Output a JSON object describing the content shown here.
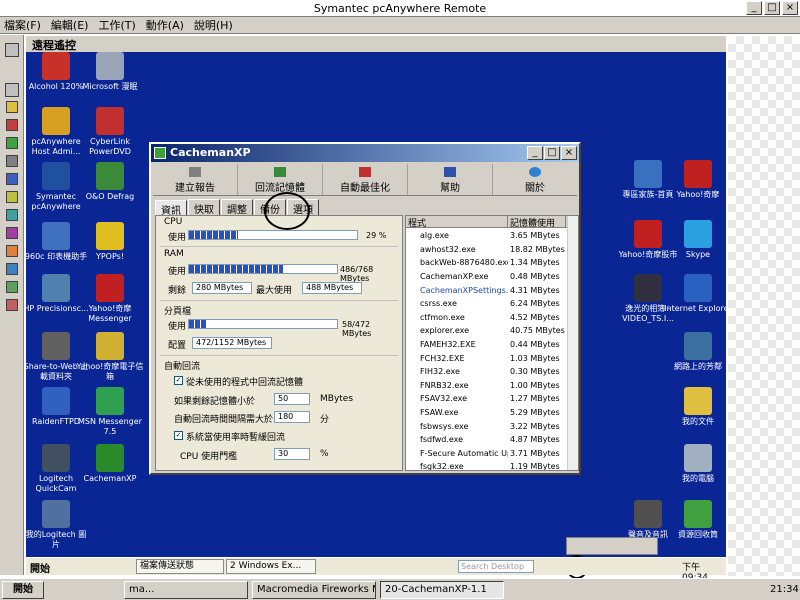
{
  "outer": {
    "title": "Symantec pcAnywhere Remote",
    "menu": [
      "檔案(F)",
      "編輯(E)",
      "工作(T)",
      "動作(A)",
      "說明(H)"
    ],
    "section_label": "遠程遙控"
  },
  "desktop": {
    "left_icons": [
      {
        "label": "Alcohol 120%",
        "color": "#c8302a"
      },
      {
        "label": "Microsoft 漫眠",
        "color": "#9aa4b8"
      },
      {
        "label": "pcAnywhere Host Admi...",
        "color": "#d8a020"
      },
      {
        "label": "CyberLink PowerDVD",
        "color": "#c03030"
      },
      {
        "label": "Symantec pcAnywhere",
        "color": "#2050a0"
      },
      {
        "label": "O&O Defrag",
        "color": "#3a8a3a"
      },
      {
        "label": "960c 印表機助手",
        "color": "#4070c0"
      },
      {
        "label": "YPOPs!",
        "color": "#e0c020"
      },
      {
        "label": "HP Precisionsc...",
        "color": "#5080b0"
      },
      {
        "label": "Yahoo!奇摩 Messenger",
        "color": "#c02020"
      },
      {
        "label": "Share-to-Web 上載資料夾",
        "color": "#606060"
      },
      {
        "label": "Yahoo!奇摩電子信箱",
        "color": "#d0b030"
      },
      {
        "label": "RaidenFTPD",
        "color": "#3060c0"
      },
      {
        "label": "MSN Messenger 7.5",
        "color": "#30a050"
      },
      {
        "label": "Logitech QuickCam",
        "color": "#405060"
      },
      {
        "label": "CachemanXP",
        "color": "#2a8a2a"
      },
      {
        "label": "我的Logitech 圖片",
        "color": "#5070a0"
      }
    ],
    "right_icons": [
      {
        "label": "專區家族-首頁",
        "color": "#3a70c0"
      },
      {
        "label": "Yahoo!奇摩",
        "color": "#c02020"
      },
      {
        "label": "Yahoo!奇摩股市",
        "color": "#c02020"
      },
      {
        "label": "Skype",
        "color": "#2aa0e0"
      },
      {
        "label": "逸光的相簿 - VIDEO_TS.I...",
        "color": "#303040"
      },
      {
        "label": "Internet Explorer",
        "color": "#2a60c0"
      },
      {
        "label": "網路上的芳鄰",
        "color": "#3a70a0"
      },
      {
        "label": "我的文件",
        "color": "#e0c040"
      },
      {
        "label": "我的電腦",
        "color": "#a0b0c0"
      },
      {
        "label": "聲音及音訊",
        "color": "#505050"
      },
      {
        "label": "資源回收筒",
        "color": "#40a040"
      }
    ]
  },
  "cacheman": {
    "title": "CachemanXP",
    "toolbar": [
      "建立報告",
      "回流記憶體",
      "自動最佳化",
      "幫助",
      "關於"
    ],
    "tabs": [
      "資訊",
      "快取",
      "調整",
      "備份",
      "選項"
    ],
    "cpu": {
      "group": "CPU",
      "row_label": "使用",
      "percent": 29,
      "value_text": "29 %"
    },
    "ram": {
      "group": "RAM",
      "row_label": "使用",
      "used_fraction": 0.633,
      "value_text": "486/768 MBytes",
      "free_label": "剩餘",
      "free_value": "280 MBytes",
      "max_label": "最大使用",
      "max_value": "488 MBytes"
    },
    "pagefile": {
      "group": "分頁檔",
      "row_label": "使用",
      "used_fraction": 0.123,
      "value_text": "58/472 MBytes",
      "config_label": "配置",
      "config_value": "472/1152 MBytes"
    },
    "auto": {
      "group": "自動回流",
      "opt1": "從未使用的程式中回流記憶體",
      "opt2_label": "如果剩餘記憶體小於",
      "opt2_value": "50",
      "opt2_unit": "MBytes",
      "opt3_label": "自動回流時間間隔需大於",
      "opt3_value": "180",
      "opt3_unit": "分",
      "opt4": "系統當使用率時暫緩回流",
      "opt5_label": "CPU 使用門檻",
      "opt5_value": "30",
      "opt5_unit": "%"
    },
    "list": {
      "headers": [
        "程式",
        "記憶體使用"
      ],
      "rows": [
        [
          "alg.exe",
          "3.65 MBytes"
        ],
        [
          "awhost32.exe",
          "18.82 MBytes"
        ],
        [
          "backWeb-8876480.exe",
          "1.34 MBytes"
        ],
        [
          "CachemanXP.exe",
          "0.48 MBytes"
        ],
        [
          "CachemanXPSettings.exe",
          "4.31 MBytes"
        ],
        [
          "csrss.exe",
          "6.24 MBytes"
        ],
        [
          "ctfmon.exe",
          "4.52 MBytes"
        ],
        [
          "explorer.exe",
          "40.75 MBytes"
        ],
        [
          "FAMEH32.EXE",
          "0.44 MBytes"
        ],
        [
          "FCH32.EXE",
          "1.03 MBytes"
        ],
        [
          "FIH32.exe",
          "0.30 MBytes"
        ],
        [
          "FNRB32.exe",
          "1.00 MBytes"
        ],
        [
          "FSAV32.exe",
          "1.27 MBytes"
        ],
        [
          "FSAW.exe",
          "5.29 MBytes"
        ],
        [
          "fsbwsys.exe",
          "3.22 MBytes"
        ],
        [
          "fsdfwd.exe",
          "4.87 MBytes"
        ],
        [
          "F-Secure Automatic Updat",
          "3.71 MBytes"
        ],
        [
          "fsgk32.exe",
          "1.19 MBytes"
        ]
      ]
    }
  },
  "remote_taskbar": {
    "start": "開始",
    "items": [
      "檔案傳送狀態",
      "2 Windows Ex..."
    ],
    "search_placeholder": "Search Desktop",
    "clock": "下午 09:34"
  },
  "local_taskbar": {
    "start": "開始",
    "items": [
      "ma...",
      "Macromedia Fireworks M...",
      "20-CachemanXP-1.1"
    ],
    "clock": "21:34"
  }
}
